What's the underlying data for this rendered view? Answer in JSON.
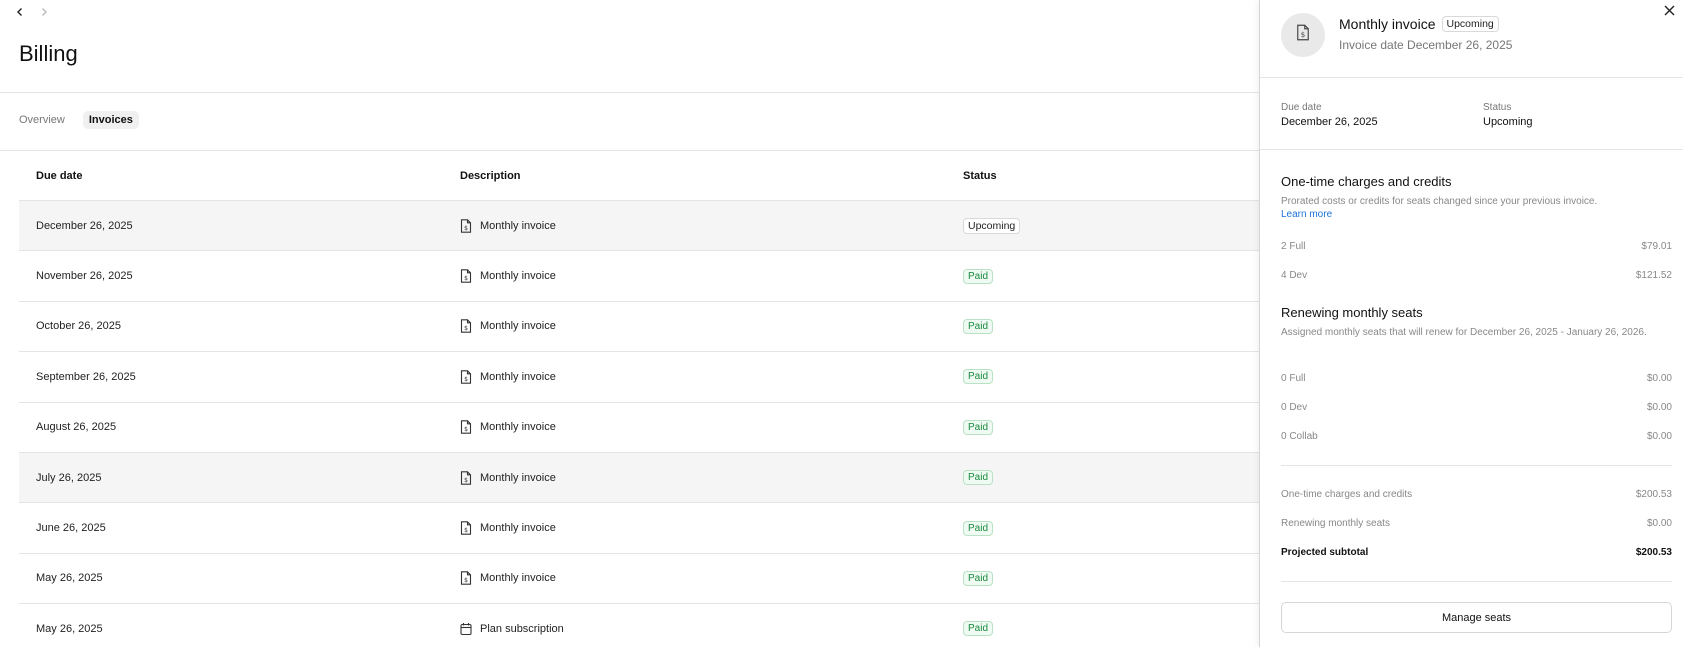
{
  "page": {
    "title": "Billing",
    "tabs": [
      {
        "label": "Overview",
        "active": false
      },
      {
        "label": "Invoices",
        "active": true
      }
    ]
  },
  "table": {
    "headers": [
      "Due date",
      "Description",
      "Status"
    ],
    "rows": [
      {
        "due_date": "December 26, 2025",
        "description": "Monthly invoice",
        "status": "Upcoming",
        "icon": "document-dollar-icon"
      },
      {
        "due_date": "November 26, 2025",
        "description": "Monthly invoice",
        "status": "Paid",
        "icon": "document-dollar-icon"
      },
      {
        "due_date": "October 26, 2025",
        "description": "Monthly invoice",
        "status": "Paid",
        "icon": "document-dollar-icon"
      },
      {
        "due_date": "September 26, 2025",
        "description": "Monthly invoice",
        "status": "Paid",
        "icon": "document-dollar-icon"
      },
      {
        "due_date": "August 26, 2025",
        "description": "Monthly invoice",
        "status": "Paid",
        "icon": "document-dollar-icon"
      },
      {
        "due_date": "July 26, 2025",
        "description": "Monthly invoice",
        "status": "Paid",
        "icon": "document-dollar-icon"
      },
      {
        "due_date": "June 26, 2025",
        "description": "Monthly invoice",
        "status": "Paid",
        "icon": "document-dollar-icon"
      },
      {
        "due_date": "May 26, 2025",
        "description": "Monthly invoice",
        "status": "Paid",
        "icon": "document-dollar-icon"
      },
      {
        "due_date": "May 26, 2025",
        "description": "Plan subscription",
        "status": "Paid",
        "icon": "calendar-icon"
      }
    ]
  },
  "panel": {
    "title": "Monthly invoice",
    "badge": "Upcoming",
    "subtitle": "Invoice date December 26, 2025",
    "due_label": "Due date",
    "due_value": "December 26, 2025",
    "status_label": "Status",
    "status_value": "Upcoming",
    "onetime": {
      "title": "One-time charges and credits",
      "desc": "Prorated costs or credits for seats changed since your previous invoice.",
      "link": "Learn more",
      "items": [
        {
          "label": "2 Full",
          "amount": "$79.01"
        },
        {
          "label": "4 Dev",
          "amount": "$121.52"
        }
      ]
    },
    "renewing": {
      "title": "Renewing monthly seats",
      "desc": "Assigned monthly seats that will renew for December 26, 2025 - January 26, 2026.",
      "items": [
        {
          "label": "0 Full",
          "amount": "$0.00"
        },
        {
          "label": "0 Dev",
          "amount": "$0.00"
        },
        {
          "label": "0 Collab",
          "amount": "$0.00"
        }
      ]
    },
    "summary": [
      {
        "label": "One-time charges and credits",
        "amount": "$200.53"
      },
      {
        "label": "Renewing monthly seats",
        "amount": "$0.00"
      },
      {
        "label": "Projected subtotal",
        "amount": "$200.53"
      }
    ],
    "button": "Manage seats"
  },
  "colors": {
    "paid_text": "#1a8a3e",
    "link": "#1a73d9"
  }
}
